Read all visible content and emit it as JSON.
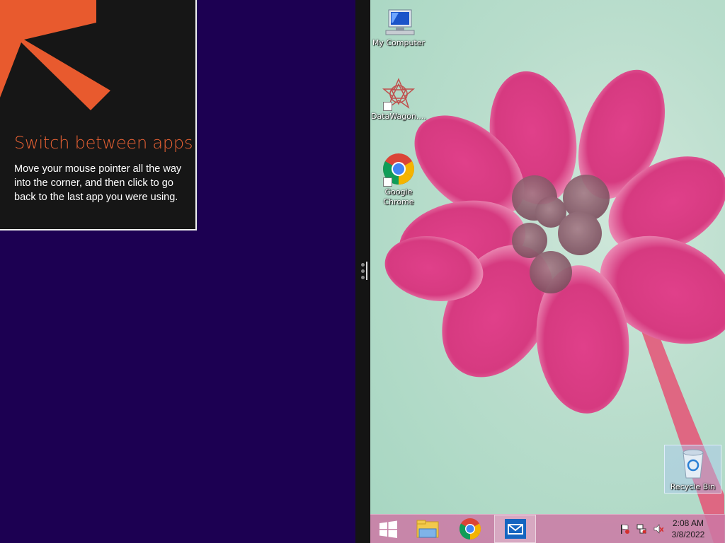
{
  "tip": {
    "title": "Switch between apps",
    "body": "Move your mouse pointer all the way into the corner, and then click to go back to the last app you were using."
  },
  "desktop": {
    "icons": [
      {
        "label": "My Computer"
      },
      {
        "label": "DataWagon...."
      },
      {
        "label": "Google Chrome"
      },
      {
        "label": "Recycle Bin"
      }
    ]
  },
  "taskbar": {
    "start_icon": "windows-start-icon",
    "pinned": [
      {
        "name": "file-explorer-icon"
      },
      {
        "name": "chrome-icon"
      },
      {
        "name": "mail-icon"
      }
    ],
    "tray": [
      "flag-icon",
      "network-icon",
      "volume-muted-icon"
    ],
    "time": "2:08 AM",
    "date": "3/8/2022"
  },
  "colors": {
    "accent": "#ea6234",
    "left_background": "#1c0052",
    "card_background": "#161616"
  }
}
